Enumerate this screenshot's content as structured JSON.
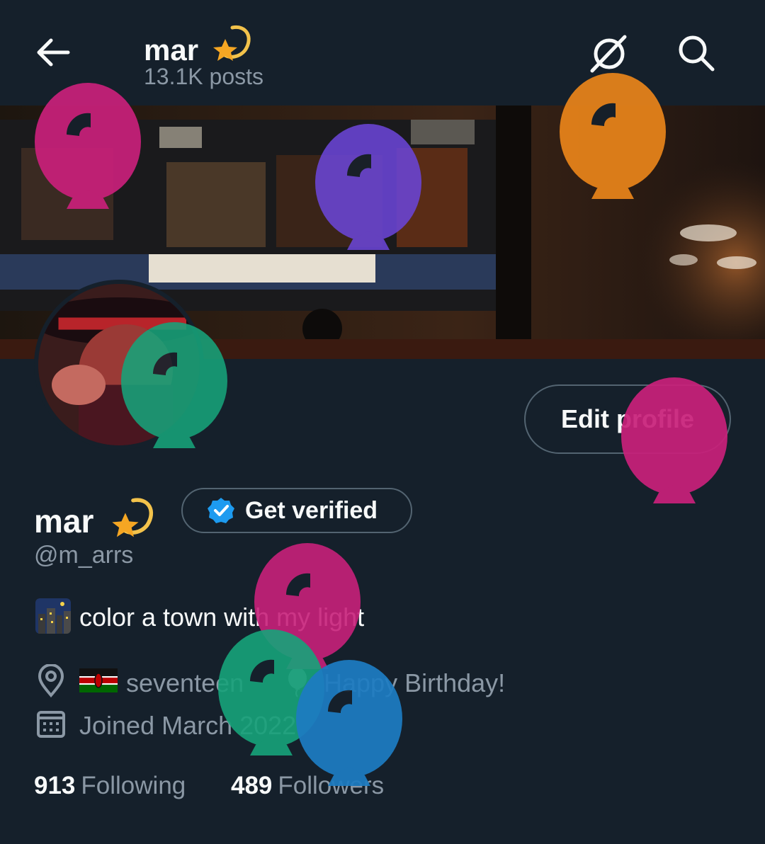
{
  "header": {
    "name": "mar",
    "posts": "13.1K posts"
  },
  "profile": {
    "edit_label": "Edit profile",
    "name": "mar",
    "verify_label": "Get verified",
    "handle": "@m_arrs",
    "bio": "color a town with my light",
    "location": "seventeen",
    "birthday": "Happy Birthday!",
    "joined": "Joined March 2022",
    "following_count": "913",
    "following_label": "Following",
    "followers_count": "489",
    "followers_label": "Followers"
  },
  "icons": [
    "back-arrow-icon",
    "sparkle-star-icon",
    "grok-icon",
    "search-icon",
    "verified-badge-icon",
    "night-city-emoji-icon",
    "location-pin-icon",
    "kenya-flag-icon",
    "balloon-icon",
    "calendar-icon"
  ],
  "colors": {
    "background": "#15202b",
    "text_primary": "#f7f9f9",
    "text_secondary": "#8b98a5",
    "border": "#536471",
    "verified_blue": "#1d9bf0",
    "balloon_pink": "#c8207a",
    "balloon_purple": "#6a45d6",
    "balloon_orange": "#e8841a",
    "balloon_green": "#17a37a",
    "balloon_blue": "#1d7cc2"
  }
}
